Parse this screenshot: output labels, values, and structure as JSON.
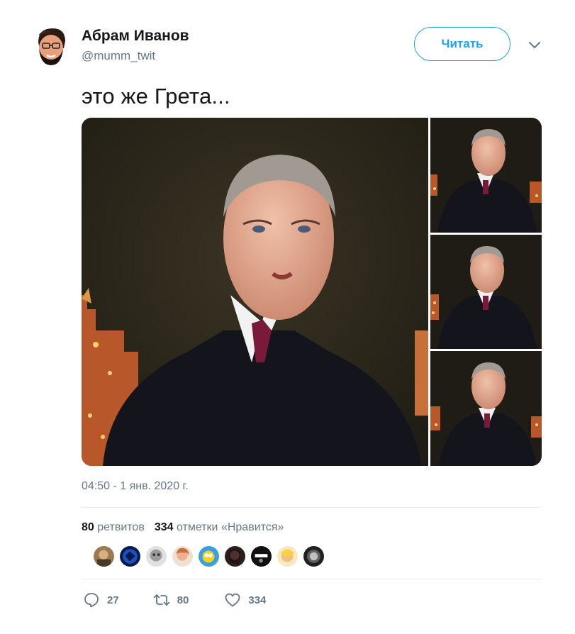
{
  "author": {
    "name": "Абрам Иванов",
    "handle": "@mumm_twit"
  },
  "follow_button": {
    "label": "Читать"
  },
  "menu_icon": "chevron-down-icon",
  "tweet": {
    "text": "это же Грета...",
    "timestamp": "04:50 - 1 янв. 2020 г."
  },
  "stats": {
    "retweets_count": "80",
    "retweets_label": "ретвитов",
    "likes_count": "334",
    "likes_label": "отметки «Нравится»"
  },
  "actions": {
    "reply_count": "27",
    "retweet_count": "80",
    "like_count": "334"
  },
  "colors": {
    "accent": "#1da1f2",
    "text": "#14171a",
    "muted": "#657786",
    "divider": "#e6ecf0"
  }
}
